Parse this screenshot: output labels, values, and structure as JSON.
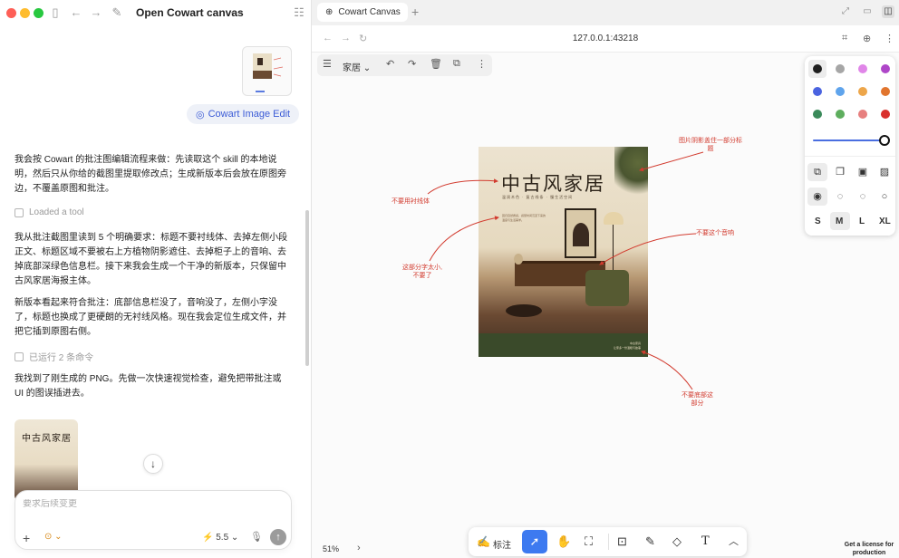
{
  "left_pane": {
    "window_title": "Open Cowart canvas",
    "skill_pill": "Cowart Image Edit",
    "messages": [
      "我会按 Cowart 的批注图编辑流程来做：先读取这个 skill 的本地说明，然后只从你给的截图里提取修改点；生成新版本后会放在原图旁边，不覆盖原图和批注。",
      "我从批注截图里读到 5 个明确要求：标题不要衬线体、去掉左侧小段正文、标题区域不要被右上方植物阴影遮住、去掉柜子上的音响、去掉底部深绿色信息栏。接下来我会生成一个干净的新版本，只保留中古风家居海报主体。",
      "新版本看起来符合批注：底部信息栏没了，音响没了，左侧小字没了，标题也换成了更硬朗的无衬线风格。现在我会定位生成文件，并把它插到原图右侧。",
      "我找到了刚生成的 PNG。先做一次快速视觉检查，避免把带批注或 UI 的图误插进去。"
    ],
    "tool_lines": [
      "Loaded a tool",
      "已运行 2 条命令"
    ],
    "result_thumb_title": "中古风家居",
    "composer": {
      "placeholder": "要求后续变更",
      "model": "5.5"
    }
  },
  "right_pane": {
    "tab_title": "Cowart Canvas",
    "url": "127.0.0.1:43218",
    "canvas_toolbar_label": "家居",
    "poster": {
      "title": "中古风家居",
      "subtitle": "温润木色 · 复古线条 · 慢生活空间",
      "small_text": "回归自然质感，感受时间沉淀下来的温度与生活美学。",
      "footer_text": "中古家具\n让家多一份温暖与故事"
    },
    "annotations": {
      "no_serif": "不要用衬线体",
      "shadow": "图片阴影盖住一部分标\n题",
      "speaker": "不要这个音响",
      "small_text": "这部分字太小,\n不要了",
      "bottom": "不要底部这\n部分"
    },
    "style_panel": {
      "colors": [
        "#1e1e1e",
        "#a6a6a6",
        "#e086e8",
        "#ae46c8",
        "#4a63e0",
        "#5fa4ec",
        "#eda64a",
        "#e1752e",
        "#3a8a5a",
        "#5eae5e",
        "#e7807f",
        "#d9302c"
      ],
      "sizes": [
        "S",
        "M",
        "L",
        "XL"
      ],
      "selected_size": "M"
    },
    "bottom_toolbar": {
      "annotate_label": "标注"
    },
    "zoom": "51%",
    "license_text": "Get a license for production"
  }
}
